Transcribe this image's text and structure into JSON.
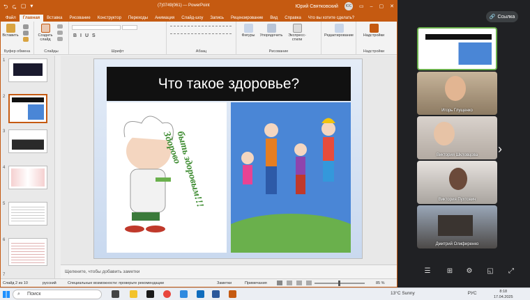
{
  "app": {
    "quick_access": [
      "⮌",
      "⮎",
      "▢",
      "▾"
    ],
    "title": "(7)0749(061) — PowerPoint",
    "user": "Юрий Святковский",
    "user_initials": "ЮС",
    "win_controls": [
      "▭",
      "–",
      "▢",
      "✕"
    ]
  },
  "tabs": [
    "Файл",
    "Главная",
    "Вставка",
    "Рисование",
    "Конструктор",
    "Переходы",
    "Анимация",
    "Слайд-шоу",
    "Запись",
    "Рецензирование",
    "Вид",
    "Справка",
    "Что вы хотите сделать?"
  ],
  "ribbon": {
    "groups": [
      "Буфер обмена",
      "Слайды",
      "Шрифт",
      "Абзац",
      "Рисование",
      "",
      "Надстройки"
    ],
    "paste": "Вставить",
    "new_slide": "Создать слайд",
    "shapes": "Фигуры",
    "arrange": "Упорядочить",
    "quick_styles": "Экспресс-стили",
    "editing": "Редактирование",
    "addins": "Надстройки"
  },
  "slides": {
    "numbers": [
      "1",
      "2",
      "3",
      "4",
      "5",
      "6",
      "7"
    ],
    "selected_index": 1
  },
  "slide": {
    "title": "Что такое здоровье?",
    "text1": "Здорово",
    "text2": "быть здоровым!!!"
  },
  "notes": {
    "placeholder": "Щелкните, чтобы добавить заметки"
  },
  "status": {
    "slide_count": "Слайд 2 из 10",
    "lang": "русский",
    "accessibility": "Специальные возможности: проверьте рекомендации",
    "notes_btn": "Заметки",
    "comments_btn": "Примечания",
    "zoom": "85 %"
  },
  "meeting": {
    "link_button": "Ссылка",
    "participants": [
      "Игорь Глущенко",
      "Виктория Шкловцова",
      "Виктория Пухтович",
      "Дмитрий Олифиренко"
    ],
    "controls": [
      "☰",
      "⊞",
      "⚙",
      "◱",
      "⤢"
    ],
    "next_arrow": "›"
  },
  "taskbar": {
    "search_placeholder": "Поиск",
    "weather": "13°C Sunny",
    "lang": "РУС",
    "time": "8:18",
    "date": "17.04.2025"
  },
  "colors": {
    "accent": "#c55a11",
    "meet_bg": "#202124"
  }
}
